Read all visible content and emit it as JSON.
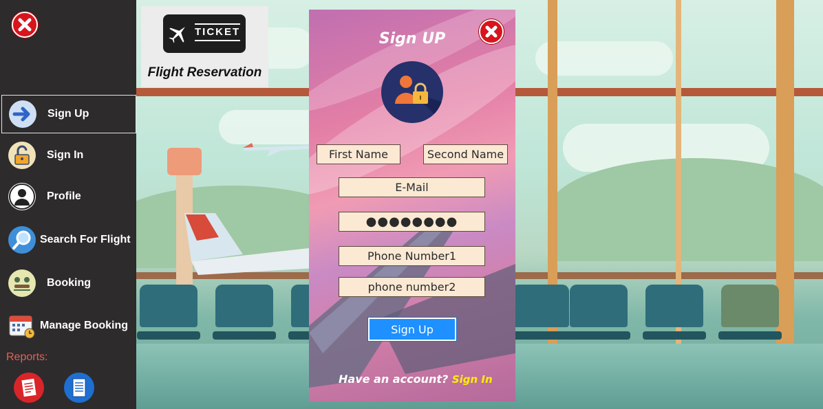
{
  "app": {
    "brand_text": "TICKET",
    "title": "Flight Reservation"
  },
  "sidebar": {
    "items": [
      {
        "label": "Sign Up",
        "icon": "arrow-right-icon",
        "active": true
      },
      {
        "label": "Sign In",
        "icon": "unlock-icon",
        "active": false
      },
      {
        "label": "Profile",
        "icon": "user-icon",
        "active": false
      },
      {
        "label": "Search For Flight",
        "icon": "search-icon",
        "active": false
      },
      {
        "label": "Booking",
        "icon": "meeting-icon",
        "active": false
      },
      {
        "label": "Manage Booking",
        "icon": "calendar-icon",
        "active": false
      }
    ],
    "reports_label": "Reports:",
    "reports": [
      {
        "icon": "report-red-icon"
      },
      {
        "icon": "report-blue-icon"
      }
    ]
  },
  "signup": {
    "title": "Sign UP",
    "first_name": "First Name",
    "second_name": "Second Name",
    "email": "E-Mail",
    "password": "●●●●●●●●",
    "phone1": "Phone Number1",
    "phone2": "phone number2",
    "submit_label": "Sign Up",
    "footer_text": "Have an account?",
    "signin_link": "Sign In"
  },
  "colors": {
    "sidebar_bg": "#2d2b2c",
    "close_red": "#d8141c",
    "reports_label": "#e0625a",
    "button_blue": "#1e90ff",
    "field_bg": "#fbe9d4",
    "link_yellow": "#ffee00"
  }
}
